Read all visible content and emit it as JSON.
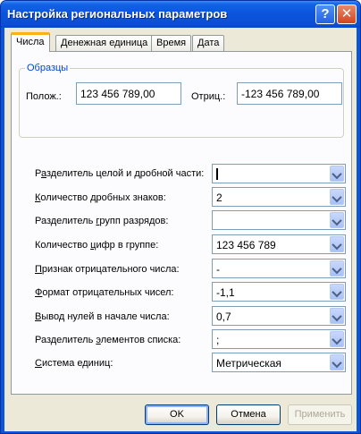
{
  "window": {
    "title": "Настройка региональных параметров",
    "help_glyph": "?",
    "close_glyph": "✕"
  },
  "tabs": [
    {
      "label": "Числа",
      "active": true
    },
    {
      "label": "Денежная единица",
      "active": false
    },
    {
      "label": "Время",
      "active": false
    },
    {
      "label": "Дата",
      "active": false
    }
  ],
  "samples": {
    "legend": "Образцы",
    "positive_label": "Полож.:",
    "positive_value": "123 456 789,00",
    "negative_label": "Отриц.:",
    "negative_value": "-123 456 789,00"
  },
  "settings": [
    {
      "label_pre": "Р",
      "label_ul": "а",
      "label_post": "зделитель целой и дробной части:",
      "value": ""
    },
    {
      "label_pre": "",
      "label_ul": "К",
      "label_post": "оличество дробных знаков:",
      "value": "2"
    },
    {
      "label_pre": "Разделитель ",
      "label_ul": "г",
      "label_post": "рупп разрядов:",
      "value": ""
    },
    {
      "label_pre": "Количество ",
      "label_ul": "ц",
      "label_post": "ифр в группе:",
      "value": "123 456 789"
    },
    {
      "label_pre": "",
      "label_ul": "П",
      "label_post": "ризнак отрицательного числа:",
      "value": "-"
    },
    {
      "label_pre": "",
      "label_ul": "Ф",
      "label_post": "ормат отрицательных чисел:",
      "value": "-1,1"
    },
    {
      "label_pre": "",
      "label_ul": "В",
      "label_post": "ывод нулей в начале числа:",
      "value": "0,7"
    },
    {
      "label_pre": "Разделитель ",
      "label_ul": "э",
      "label_post": "лементов списка:",
      "value": ";"
    },
    {
      "label_pre": "",
      "label_ul": "С",
      "label_post": "истема единиц:",
      "value": "Метрическая"
    }
  ],
  "buttons": {
    "ok": "OK",
    "cancel": "Отмена",
    "apply": "Применить",
    "apply_enabled": false
  },
  "colors": {
    "titlebar": "#0a54dc",
    "dialog_bg": "#ece9d8",
    "active_tab_accent": "#f9b119",
    "group_legend": "#0046d5"
  }
}
